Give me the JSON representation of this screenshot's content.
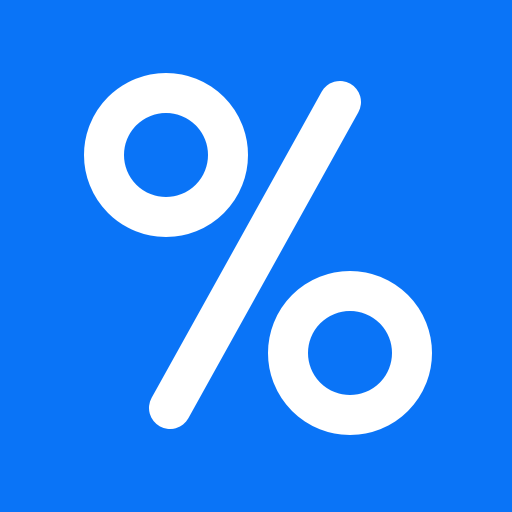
{
  "icon": {
    "name": "percent-icon",
    "background_color": "#0a74f7",
    "glyph_color": "#ffffff"
  }
}
